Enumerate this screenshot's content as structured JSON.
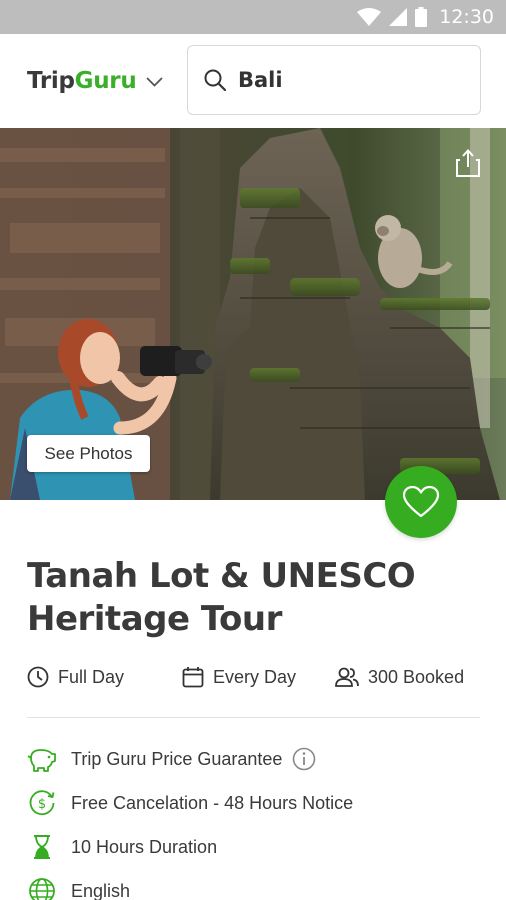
{
  "status_bar": {
    "time": "12:30"
  },
  "header": {
    "brand_part1": "Trip",
    "brand_part2": "Guru",
    "search": {
      "value": "Bali"
    }
  },
  "hero": {
    "see_photos_label": "See Photos"
  },
  "tour": {
    "title_line1": "Tanah Lot & UNESCO",
    "title_line2": "Heritage Tour"
  },
  "meta": {
    "duration": "Full Day",
    "schedule": "Every Day",
    "booked": "300 Booked"
  },
  "features": [
    {
      "label": "Trip Guru Price Guarantee",
      "icon": "piggy-bank-icon"
    },
    {
      "label": "Free Cancelation - 48 Hours Notice",
      "icon": "dollar-refund-icon"
    },
    {
      "label": "10 Hours Duration",
      "icon": "hourglass-icon"
    },
    {
      "label": "English",
      "icon": "globe-icon"
    }
  ],
  "colors": {
    "accent": "#36ad21",
    "status_bar": "#bdbdbd",
    "text": "#3a3a3a"
  }
}
